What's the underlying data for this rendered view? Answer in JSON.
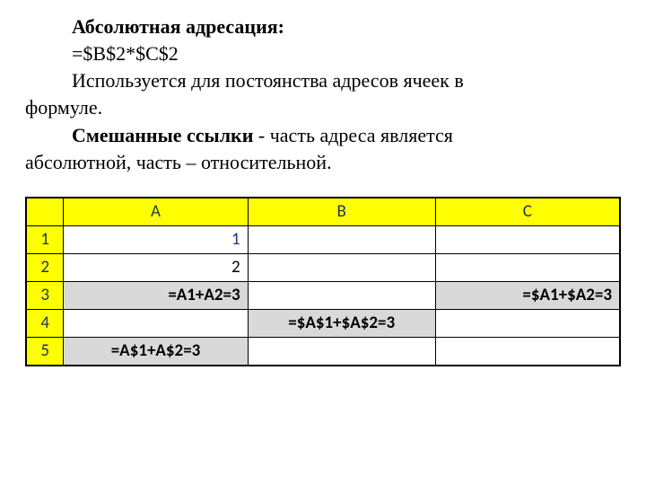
{
  "text": {
    "heading": "Абсолютная адресация:",
    "formula": "=$B$2*$C$2",
    "body1a": "Используется для постоянства адресов ячеек в",
    "body1b": "формуле.",
    "body2a_bold": "Смешанные ссылки",
    "body2a_rest": " - часть адреса является",
    "body2b": "абсолютной, часть – относительной."
  },
  "sheet": {
    "cols": [
      "A",
      "B",
      "C"
    ],
    "rows": [
      "1",
      "2",
      "3",
      "4",
      "5"
    ],
    "cells": {
      "A1": "1",
      "A2": "2",
      "A3": "=A1+A2=3",
      "B4": "=$A$1+$A$2=3",
      "C3": "=$A1+$A2=3",
      "A5": "=A$1+A$2=3"
    }
  }
}
